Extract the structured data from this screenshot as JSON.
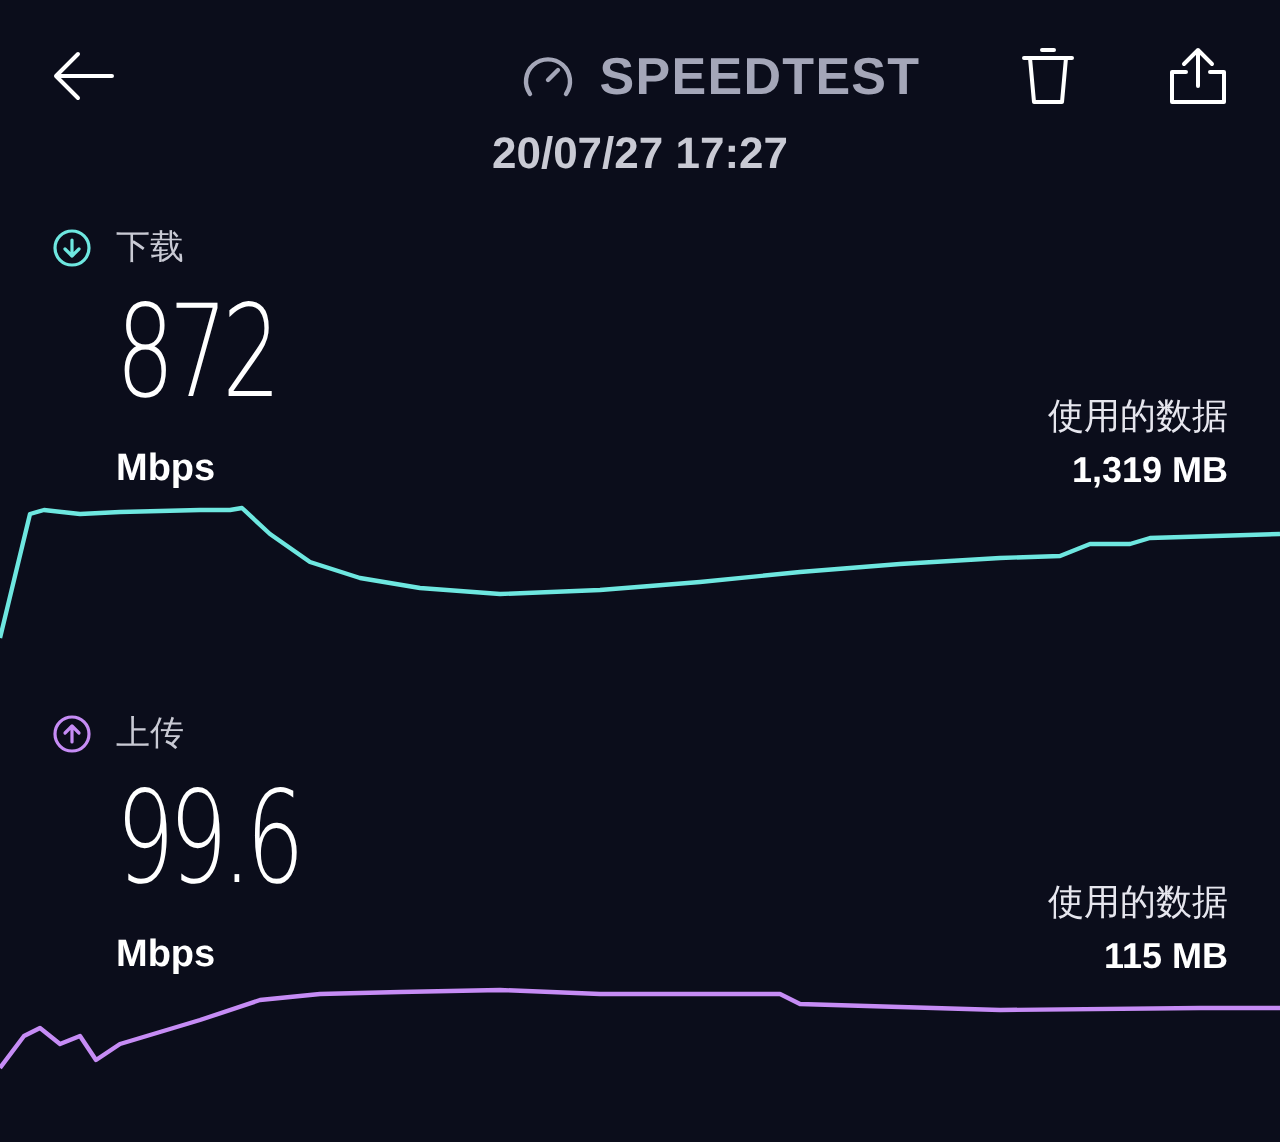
{
  "header": {
    "title": "SPEEDTEST",
    "datetime": "20/07/27 17:27"
  },
  "results": [
    {
      "kind": "download",
      "label": "下载",
      "value": "872",
      "unit": "Mbps",
      "data_label": "使用的数据",
      "data_amount": "1,319 MB",
      "color": "#6ee7e0"
    },
    {
      "kind": "upload",
      "label": "上传",
      "value": "99.6",
      "unit": "Mbps",
      "data_label": "使用的数据",
      "data_amount": "115 MB",
      "color": "#c68cf5"
    }
  ]
}
